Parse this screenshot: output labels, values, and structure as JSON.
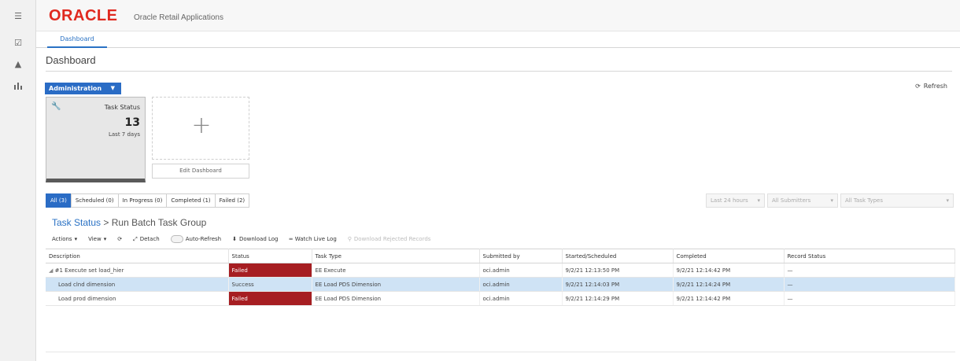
{
  "header": {
    "logo": "ORACLE",
    "app_name": "Oracle Retail Applications"
  },
  "tabs": [
    {
      "label": "Dashboard"
    }
  ],
  "page": {
    "title": "Dashboard"
  },
  "toolbar_top": {
    "admin_label": "Administration",
    "refresh_label": "Refresh"
  },
  "tile": {
    "label": "Task Status",
    "count": "13",
    "sub": "Last 7 days"
  },
  "edit_dashboard_label": "Edit Dashboard",
  "filter_tabs": [
    {
      "label": "All (3)"
    },
    {
      "label": "Scheduled (0)"
    },
    {
      "label": "In Progress (0)"
    },
    {
      "label": "Completed (1)"
    },
    {
      "label": "Failed (2)"
    }
  ],
  "filters": {
    "time": "Last 24 hours",
    "submitters": "All Submitters",
    "task_types": "All Task Types"
  },
  "breadcrumb": {
    "root": "Task Status",
    "sep": ">",
    "current": "Run Batch Task Group"
  },
  "grid_toolbar": {
    "actions": "Actions",
    "view": "View",
    "detach": "Detach",
    "auto_refresh": "Auto-Refresh",
    "download_log": "Download Log",
    "watch_live_log": "Watch Live Log",
    "download_rejected": "Download Rejected Records"
  },
  "table": {
    "columns": [
      "Description",
      "Status",
      "Task Type",
      "Submitted by",
      "Started/Scheduled",
      "Completed",
      "Record Status"
    ],
    "rows": [
      {
        "description": "#1 Execute set load_hier",
        "status": "Failed",
        "task_type": "EE Execute",
        "submitted_by": "oci.admin",
        "started": "9/2/21 12:13:50 PM",
        "completed": "9/2/21 12:14:42 PM",
        "record_status": "—"
      },
      {
        "description": "Load clnd dimension",
        "status": "Success",
        "task_type": "EE Load PDS Dimension",
        "submitted_by": "oci.admin",
        "started": "9/2/21 12:14:03 PM",
        "completed": "9/2/21 12:14:24 PM",
        "record_status": "—"
      },
      {
        "description": "Load prod dimension",
        "status": "Failed",
        "task_type": "EE Load PDS Dimension",
        "submitted_by": "oci.admin",
        "started": "9/2/21 12:14:29 PM",
        "completed": "9/2/21 12:14:42 PM",
        "record_status": "—"
      }
    ]
  },
  "colors": {
    "brand_red": "#e0291f",
    "accent_blue": "#2a6cc5",
    "failed": "#a61e22",
    "selected_row": "#cfe3f5"
  }
}
